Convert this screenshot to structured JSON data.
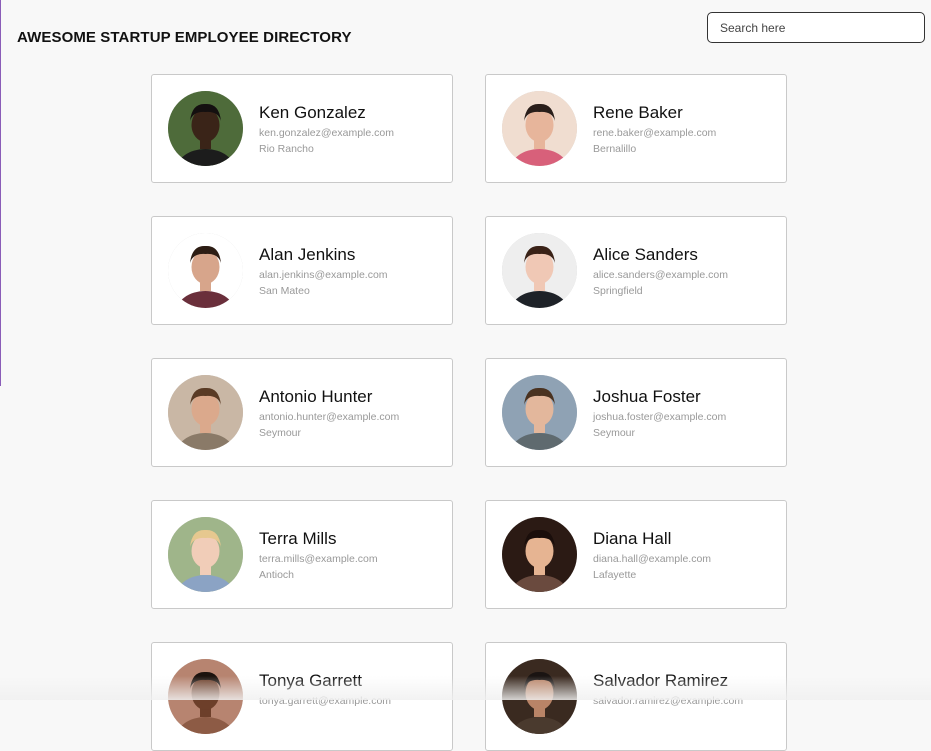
{
  "header": {
    "title": "AWESOME STARTUP EMPLOYEE DIRECTORY",
    "search_placeholder": "Search here"
  },
  "employees": [
    {
      "name": "Ken Gonzalez",
      "email": "ken.gonzalez@example.com",
      "city": "Rio Rancho",
      "avatar": {
        "bg": "#4e6b3a",
        "skin": "#3a2418",
        "hair": "#141010",
        "shirt": "#1c1c1c"
      }
    },
    {
      "name": "Rene Baker",
      "email": "rene.baker@example.com",
      "city": "Bernalillo",
      "avatar": {
        "bg": "#f0ddd0",
        "skin": "#e7b59b",
        "hair": "#2a1e1a",
        "shirt": "#d8607a"
      }
    },
    {
      "name": "Alan Jenkins",
      "email": "alan.jenkins@example.com",
      "city": "San Mateo",
      "avatar": {
        "bg": "#ffffff",
        "skin": "#d7a58b",
        "hair": "#2d1d14",
        "shirt": "#6a2f3b"
      }
    },
    {
      "name": "Alice Sanders",
      "email": "alice.sanders@example.com",
      "city": "Springfield",
      "avatar": {
        "bg": "#eeeeee",
        "skin": "#f0c8b5",
        "hair": "#3a2217",
        "shirt": "#1e2228"
      }
    },
    {
      "name": "Antonio Hunter",
      "email": "antonio.hunter@example.com",
      "city": "Seymour",
      "avatar": {
        "bg": "#c9b7a5",
        "skin": "#dba98c",
        "hair": "#5a3b25",
        "shirt": "#8a7a68"
      }
    },
    {
      "name": "Joshua Foster",
      "email": "joshua.foster@example.com",
      "city": "Seymour",
      "avatar": {
        "bg": "#8fa2b4",
        "skin": "#e3b79c",
        "hair": "#4a3220",
        "shirt": "#5f6a6f"
      }
    },
    {
      "name": "Terra Mills",
      "email": "terra.mills@example.com",
      "city": "Antioch",
      "avatar": {
        "bg": "#9fb58a",
        "skin": "#f1cdb8",
        "hair": "#e6c88f",
        "shirt": "#8ba3c4"
      }
    },
    {
      "name": "Diana Hall",
      "email": "diana.hall@example.com",
      "city": "Lafayette",
      "avatar": {
        "bg": "#2b1a14",
        "skin": "#e6b492",
        "hair": "#1a0e0b",
        "shirt": "#6a4a3e"
      }
    },
    {
      "name": "Tonya Garrett",
      "email": "tonya.garrett@example.com",
      "city": "",
      "avatar": {
        "bg": "#b78470",
        "skin": "#6d3f2a",
        "hair": "#1c120d",
        "shirt": "#8d5b45"
      }
    },
    {
      "name": "Salvador Ramirez",
      "email": "salvador.ramirez@example.com",
      "city": "",
      "avatar": {
        "bg": "#3a2a20",
        "skin": "#b98467",
        "hair": "#1a1412",
        "shirt": "#4a3a2e"
      }
    }
  ]
}
